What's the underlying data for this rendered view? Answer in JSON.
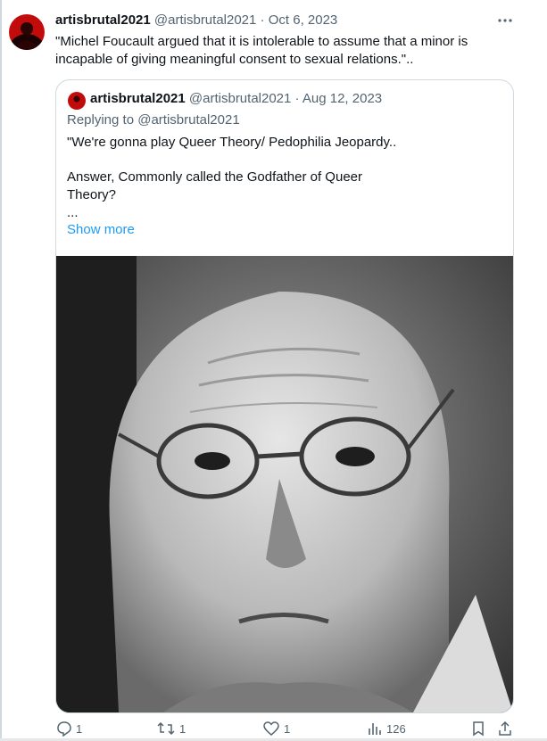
{
  "tweet": {
    "author_name": "artisbrutal2021",
    "author_handle": "@artisbrutal2021",
    "separator": "·",
    "date": "Oct 6, 2023",
    "more_icon": "ellipsis-icon",
    "text": "\"Michel Foucault argued that it is intolerable to assume that a minor is incapable of giving meaningful consent to sexual relations.\".."
  },
  "quote": {
    "author_name": "artisbrutal2021",
    "author_handle": "@artisbrutal2021",
    "separator": "·",
    "date": "Aug 12, 2023",
    "replying_to": "Replying to @artisbrutal2021",
    "lines": [
      "\"We're gonna play Queer Theory/ Pedophilia Jeopardy..",
      "Answer,  Commonly called the Godfather of Queer",
      "Theory?",
      "..."
    ],
    "show_more": "Show more"
  },
  "actions": {
    "reply": "1",
    "retweet": "1",
    "like": "1",
    "views": "126"
  },
  "colors": {
    "link": "#1d9bf0",
    "muted": "#536471",
    "text": "#0f1419",
    "border": "#cfd9de"
  }
}
